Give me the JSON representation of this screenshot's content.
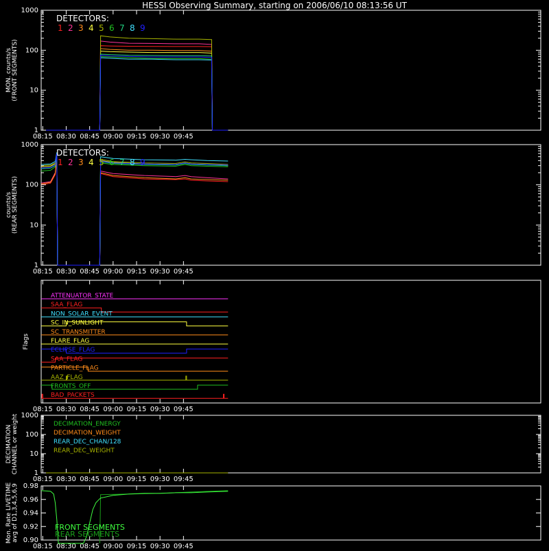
{
  "title": "HESSI Observing Summary, starting on 2006/06/10 08:13:56 UT",
  "time_ticks": [
    "08:15",
    "08:30",
    "08:45",
    "09:00",
    "09:15",
    "09:30",
    "09:45"
  ],
  "time_range_min": [
    494,
    813.5
  ],
  "colors": {
    "axis": "#ffffff",
    "d1": "#ff2020",
    "d2": "#ff3399",
    "d3": "#ff8c1a",
    "d4": "#ffff40",
    "d5": "#a8b400",
    "d6": "#20c020",
    "d7": "#20d080",
    "d8": "#40e0ff",
    "d9": "#2020ff"
  },
  "chart_data": [
    {
      "id": "front",
      "type": "line",
      "ylabel_lines": [
        "MON. counts/s",
        "(FRONT SEGMENTS)"
      ],
      "yscale": "log",
      "ylim": [
        1,
        1000
      ],
      "yticks": [
        "1",
        "10",
        "100",
        "1000"
      ],
      "legend_title": "DETECTORS:",
      "legend_items": [
        "1",
        "2",
        "3",
        "4",
        "5",
        "6",
        "7",
        "8",
        "9"
      ],
      "x": [
        494,
        531.5,
        532,
        538,
        550,
        565,
        580,
        595,
        603,
        603.5,
        613.5
      ],
      "series": [
        {
          "values": [
            1,
            1,
            130,
            128,
            126,
            125,
            124,
            124,
            123,
            1,
            1
          ]
        },
        {
          "values": [
            1,
            1,
            170,
            160,
            150,
            148,
            145,
            145,
            140,
            1,
            1
          ]
        },
        {
          "values": [
            1,
            1,
            110,
            105,
            100,
            100,
            98,
            98,
            95,
            1,
            1
          ]
        },
        {
          "values": [
            1,
            1,
            95,
            92,
            90,
            88,
            88,
            88,
            85,
            1,
            1
          ]
        },
        {
          "values": [
            1,
            1,
            230,
            215,
            200,
            195,
            190,
            190,
            185,
            1,
            1
          ]
        },
        {
          "values": [
            1,
            1,
            70,
            68,
            65,
            62,
            62,
            62,
            60,
            1,
            1
          ]
        },
        {
          "values": [
            1,
            1,
            80,
            78,
            75,
            74,
            73,
            73,
            72,
            1,
            1
          ]
        },
        {
          "values": [
            1,
            1,
            65,
            63,
            60,
            60,
            58,
            58,
            57,
            1,
            1
          ]
        },
        {
          "values": [
            1,
            1,
            75,
            72,
            70,
            68,
            68,
            68,
            66,
            1,
            1
          ]
        }
      ]
    },
    {
      "id": "rear",
      "type": "line",
      "ylabel_lines": [
        "counts/s",
        "(REAR SEGMENTS)"
      ],
      "yscale": "log",
      "ylim": [
        1,
        1000
      ],
      "yticks": [
        "1",
        "10",
        "100",
        "1000"
      ],
      "legend_title": "DETECTORS:",
      "legend_items": [
        "1",
        "2",
        "3",
        "4",
        "5",
        "6",
        "7",
        "8",
        "9"
      ],
      "x": [
        494,
        500,
        503,
        504,
        504.5,
        531.5,
        532,
        540,
        560,
        580,
        586,
        590,
        600,
        613.5
      ],
      "series": [
        {
          "values": [
            100,
            110,
            180,
            500,
            1,
            1,
            190,
            160,
            140,
            135,
            140,
            130,
            125,
            120
          ]
        },
        {
          "values": [
            110,
            120,
            200,
            550,
            1,
            1,
            220,
            190,
            170,
            160,
            170,
            160,
            150,
            140
          ]
        },
        {
          "values": [
            105,
            115,
            190,
            520,
            1,
            1,
            200,
            170,
            150,
            140,
            150,
            140,
            135,
            130
          ]
        },
        {
          "values": [
            280,
            290,
            330,
            600,
            1,
            1,
            400,
            360,
            330,
            320,
            350,
            330,
            320,
            300
          ]
        },
        {
          "values": [
            300,
            310,
            350,
            620,
            1,
            1,
            430,
            380,
            350,
            340,
            370,
            350,
            340,
            320
          ]
        },
        {
          "values": [
            220,
            230,
            280,
            580,
            1,
            1,
            350,
            320,
            300,
            290,
            320,
            300,
            290,
            280
          ]
        },
        {
          "values": [
            250,
            260,
            300,
            590,
            1,
            1,
            380,
            340,
            320,
            310,
            340,
            320,
            310,
            300
          ]
        },
        {
          "values": [
            320,
            330,
            380,
            640,
            1,
            1,
            500,
            450,
            420,
            410,
            430,
            420,
            400,
            390
          ]
        },
        {
          "values": [
            260,
            270,
            310,
            600,
            1,
            1,
            390,
            350,
            330,
            320,
            350,
            330,
            320,
            310
          ]
        }
      ]
    },
    {
      "id": "flags",
      "type": "line",
      "ylabel": "Flags",
      "flags": [
        {
          "name": "ATTENUATOR_STATE",
          "color": "#ff33ff",
          "steps": [
            [
              494,
              0
            ],
            [
              613.5,
              0
            ]
          ]
        },
        {
          "name": "SAA_FLAG",
          "color": "#ff2020",
          "steps": [
            [
              494,
              0
            ],
            [
              532.5,
              0
            ],
            [
              532.5,
              -1
            ],
            [
              613.5,
              -1
            ]
          ]
        },
        {
          "name": "NON_SOLAR_EVENT",
          "color": "#40e0ff",
          "steps": [
            [
              494,
              0
            ],
            [
              613.5,
              0
            ]
          ]
        },
        {
          "name": "SC_IN_SUNLIGHT",
          "color": "#ffff40",
          "steps": [
            [
              494,
              0
            ],
            [
              510,
              0
            ],
            [
              510,
              1
            ],
            [
              587,
              1
            ],
            [
              587,
              0
            ],
            [
              613.5,
              0
            ]
          ]
        },
        {
          "name": "SC_TRANSMITTER",
          "color": "#ff8c1a",
          "steps": [
            [
              494,
              0
            ],
            [
              613.5,
              0
            ]
          ]
        },
        {
          "name": "FLARE_FLAG",
          "color": "#ffff40",
          "steps": [
            [
              494,
              0
            ],
            [
              613.5,
              0
            ]
          ]
        },
        {
          "name": "ECLIPSE_FLAG",
          "color": "#2020ff",
          "steps": [
            [
              494,
              1
            ],
            [
              510,
              1
            ],
            [
              510,
              0
            ],
            [
              587,
              0
            ],
            [
              587,
              1
            ],
            [
              613.5,
              1
            ]
          ]
        },
        {
          "name": "SAA_FLAG",
          "color": "#ff2020",
          "steps": [
            [
              494,
              0
            ],
            [
              503,
              0
            ],
            [
              503,
              1
            ],
            [
              613.5,
              1
            ]
          ]
        },
        {
          "name": "PARTICLE_FLAG",
          "color": "#ff8c1a",
          "steps": [
            [
              494,
              1
            ],
            [
              524,
              1
            ],
            [
              524,
              0
            ],
            [
              613.5,
              0
            ]
          ]
        },
        {
          "name": "AAZ_FLAG",
          "color": "#a8b400",
          "steps": [
            [
              494,
              0
            ],
            [
              510,
              0
            ],
            [
              510,
              1
            ],
            [
              510.5,
              1
            ],
            [
              510.5,
              0
            ],
            [
              586.5,
              0
            ],
            [
              586.5,
              1
            ],
            [
              587,
              1
            ],
            [
              587,
              0
            ],
            [
              613.5,
              0
            ]
          ]
        },
        {
          "name": "FRONTS_OFF",
          "color": "#20c020",
          "steps": [
            [
              494,
              1
            ],
            [
              501,
              1
            ],
            [
              501,
              0
            ],
            [
              594,
              0
            ],
            [
              594,
              1
            ],
            [
              613.5,
              1
            ]
          ]
        },
        {
          "name": "BAD_PACKETS",
          "color": "#ff2020",
          "steps": [
            [
              494,
              0
            ],
            [
              494.5,
              0
            ],
            [
              494.5,
              1
            ],
            [
              495,
              1
            ],
            [
              495,
              0
            ],
            [
              610.5,
              0
            ],
            [
              610.5,
              1
            ],
            [
              611,
              1
            ],
            [
              611,
              0
            ],
            [
              613.5,
              0
            ]
          ]
        }
      ]
    },
    {
      "id": "decimation",
      "type": "line",
      "ylabel_lines": [
        "DECIMATION",
        "CHANNEL or weight"
      ],
      "yscale": "log",
      "ylim": [
        1,
        1000
      ],
      "yticks": [
        "1",
        "10",
        "100",
        "1000"
      ],
      "legend_items": [
        {
          "name": "DECIMATION_ENERGY",
          "color": "#20c020"
        },
        {
          "name": "DECIMATION_WEIGHT",
          "color": "#ff8c1a"
        },
        {
          "name": "REAR_DEC_CHAN/128",
          "color": "#40e0ff"
        },
        {
          "name": "REAR_DEC_WEIGHT",
          "color": "#a8b400"
        }
      ],
      "x": [
        494,
        613.5
      ],
      "values": [
        1,
        1
      ]
    },
    {
      "id": "livetime",
      "type": "line",
      "ylabel_lines": [
        "Mon. Rate LIVETIME",
        "avg of D1,3,4,5,6,9"
      ],
      "ylim": [
        0.9,
        0.98
      ],
      "yticks": [
        "0.90",
        "0.92",
        "0.94",
        "0.96",
        "0.98"
      ],
      "series": [
        {
          "name": "FRONT SEGMENTS",
          "color": "#40ff40",
          "x": [
            494,
            500,
            502,
            503,
            504,
            505,
            521,
            523,
            525,
            527,
            529,
            531,
            532,
            540,
            550,
            560,
            570,
            580,
            590,
            600,
            613.5
          ],
          "values": [
            0.973,
            0.972,
            0.968,
            0.955,
            0.93,
            0.895,
            0.895,
            0.905,
            0.925,
            0.945,
            0.955,
            0.96,
            0.962,
            0.966,
            0.968,
            0.969,
            0.969,
            0.97,
            0.97,
            0.971,
            0.972
          ]
        },
        {
          "name": "REAR SEGMENTS",
          "color": "#1aa01a",
          "x": [
            531.5,
            532,
            550,
            570,
            590,
            613.5
          ],
          "values": [
            0.895,
            0.967,
            0.968,
            0.969,
            0.971,
            0.973
          ]
        }
      ]
    }
  ]
}
